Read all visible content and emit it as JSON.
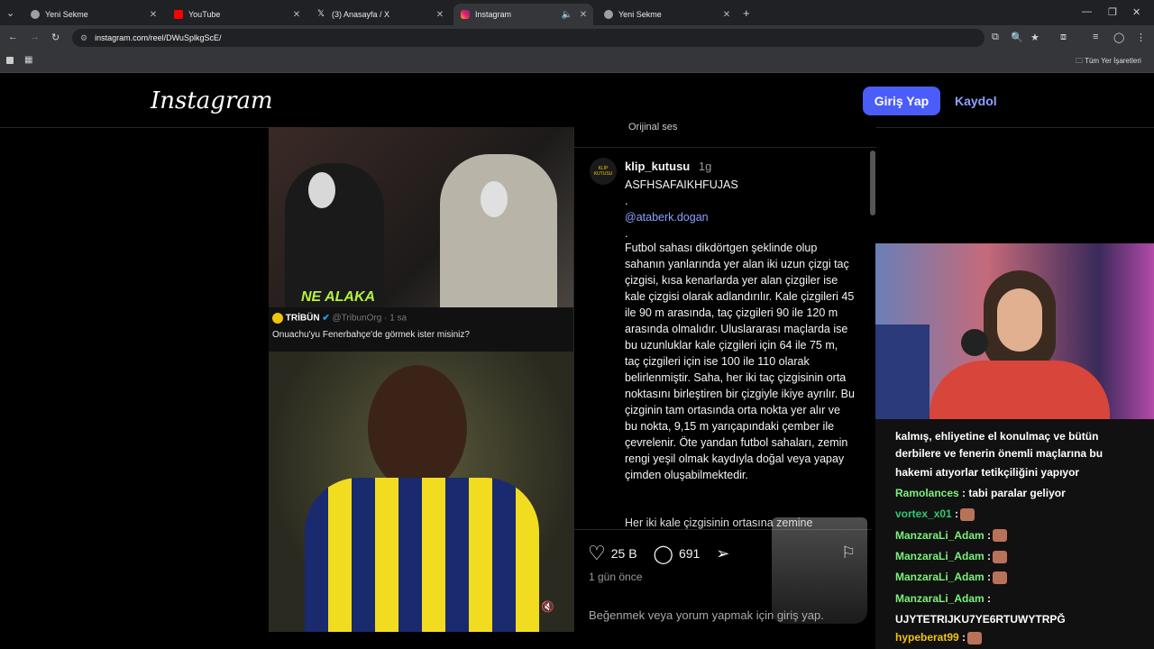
{
  "browser": {
    "tabs": [
      {
        "label": "Yeni Sekme",
        "icon": "chrome-icon"
      },
      {
        "label": "YouTube",
        "icon": "youtube-icon"
      },
      {
        "label": "(3) Anasayfa / X",
        "icon": "x-icon"
      },
      {
        "label": "Instagram",
        "icon": "instagram-icon"
      },
      {
        "label": "Yeni Sekme",
        "icon": "chrome-icon"
      }
    ],
    "url": "instagram.com/reel/DWuSplkgScE/",
    "bookmarks_all": "Tüm Yer İşaretleri"
  },
  "instagram": {
    "logo": "Instagram",
    "login_label": "Giriş Yap",
    "signup_label": "Kaydol"
  },
  "video": {
    "overlay_text": "NE ALAKA",
    "tweet_brand": "TRİBÜN",
    "tweet_handle": "@TribunOrg · 1 sa",
    "tweet_text": "Onuachu'yu Fenerbahçe'de görmek ister misiniz?"
  },
  "post": {
    "audio_label": "Orijinal ses",
    "username": "klip_kutusu",
    "time": "1g",
    "avatar_text": "KLİP KUTUSU",
    "line1": "ASFHSAFAIKHFUJAS",
    "dot1": ".",
    "mention": "@ataberk.dogan",
    "dot2": ".",
    "body": "Futbol sahası dikdörtgen şeklinde olup sahanın yanlarında yer alan iki uzun çizgi taç çizgisi, kısa kenarlarda yer alan çizgiler ise kale çizgisi olarak adlandırılır. Kale çizgileri 45 ile 90 m arasında, taç çizgileri 90 ile 120 m arasında olmalıdır. Uluslararası maçlarda ise bu uzunluklar kale çizgileri için 64 ile 75 m, taç çizgileri için ise 100 ile 110 olarak belirlenmiştir. Saha, her iki taç çizgisinin orta noktasını birleştiren bir çizgiyle ikiye ayrılır. Bu çizginin tam ortasında orta nokta yer alır ve bu nokta, 9,15 m yarıçapındaki çember ile çevrelenir. Öte yandan futbol sahaları, zemin rengi yeşil olmak kaydıyla doğal veya yapay çimden oluşabilmektedir.",
    "cut_line": "Her iki kale çizgisinin ortasına zemine",
    "likes": "25 B",
    "comments": "691",
    "posted": "1 gün önce",
    "login_prompt": "Beğenmek veya yorum yapmak için giriş yap."
  },
  "chat": {
    "partial_top": "kalmış, ehliyetine el konulmaç ve bütün",
    "lines": [
      {
        "text": "derbilere ve fenerin önemli maçlarına bu"
      },
      {
        "text": "hakemi atıyorlar tetikçiliğini yapıyor"
      }
    ],
    "messages": [
      {
        "user": "Ramolances",
        "color": "#7cf07c",
        "msg": ": tabi paralar geliyor",
        "emote": false
      },
      {
        "user": "vortex_x01",
        "color": "#2ecc71",
        "msg": ":",
        "emote": true
      },
      {
        "user": "ManzaraLi_Adam",
        "color": "#7cf07c",
        "msg": ":",
        "emote": true
      },
      {
        "user": "ManzaraLi_Adam",
        "color": "#7cf07c",
        "msg": ":",
        "emote": true
      },
      {
        "user": "ManzaraLi_Adam",
        "color": "#7cf07c",
        "msg": ":",
        "emote": true
      },
      {
        "user": "ManzaraLi_Adam",
        "color": "#7cf07c",
        "msg": ":",
        "emote": false
      },
      {
        "user": "",
        "color": "#fff",
        "msg": "UJYTETRIJKU7YE6RTUWYTRPĞ",
        "emote": false
      },
      {
        "user": "hypeberat99",
        "color": "#f1c40f",
        "msg": ":",
        "emote": true
      }
    ]
  }
}
